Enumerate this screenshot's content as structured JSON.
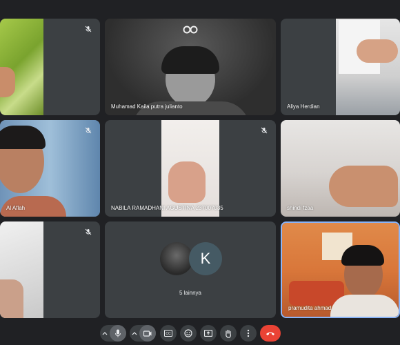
{
  "participants": [
    {
      "name": ""
    },
    {
      "name": "Muhamad Kaila putra julianto"
    },
    {
      "name": "Aliya Herdian"
    },
    {
      "name": "Al Aflah"
    },
    {
      "name": "NABILA RAMADHANI AGUSTINA 237007035"
    },
    {
      "name": "shindi fzaa"
    },
    {
      "name": ""
    },
    {
      "name": "pramudita ahmad"
    }
  ],
  "others": {
    "avatar_letter": "K",
    "label": "5 lainnya"
  },
  "controls": {
    "mic_icon": "microphone-icon",
    "camera_icon": "camera-icon",
    "captions_icon": "closed-captions-icon",
    "emoji_icon": "emoji-icon",
    "present_icon": "present-screen-icon",
    "hand_icon": "raise-hand-icon",
    "more_icon": "more-options-icon",
    "leave_icon": "leave-call-icon",
    "leave_color": "#ea4335"
  },
  "colors": {
    "background": "#202124",
    "tile": "#3c4043",
    "active_border": "#8ab4f8",
    "avatar_k": "#455a64"
  }
}
